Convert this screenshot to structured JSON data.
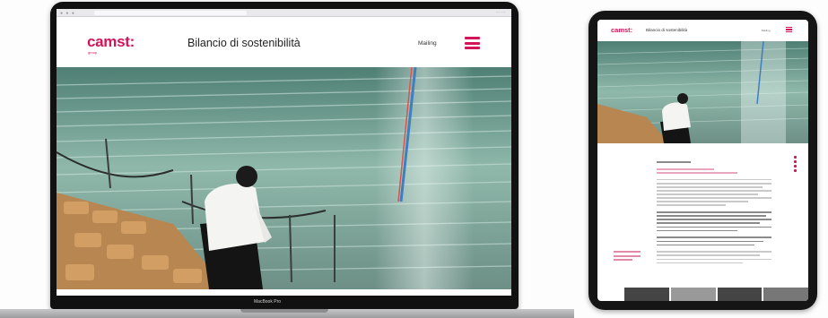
{
  "laptop": {
    "device_label": "MacBook Pro",
    "header": {
      "logo": "camst:",
      "page_title": "Bilancio di sostenibilità",
      "nav_link": "Mailing"
    }
  },
  "tablet": {
    "header": {
      "logo": "camst:",
      "page_title": "Bilancio di sostenibilità"
    }
  },
  "colors": {
    "brand": "#d4145a",
    "stadium_seats": "#7fa99c",
    "foreground_seats": "#b88650"
  }
}
